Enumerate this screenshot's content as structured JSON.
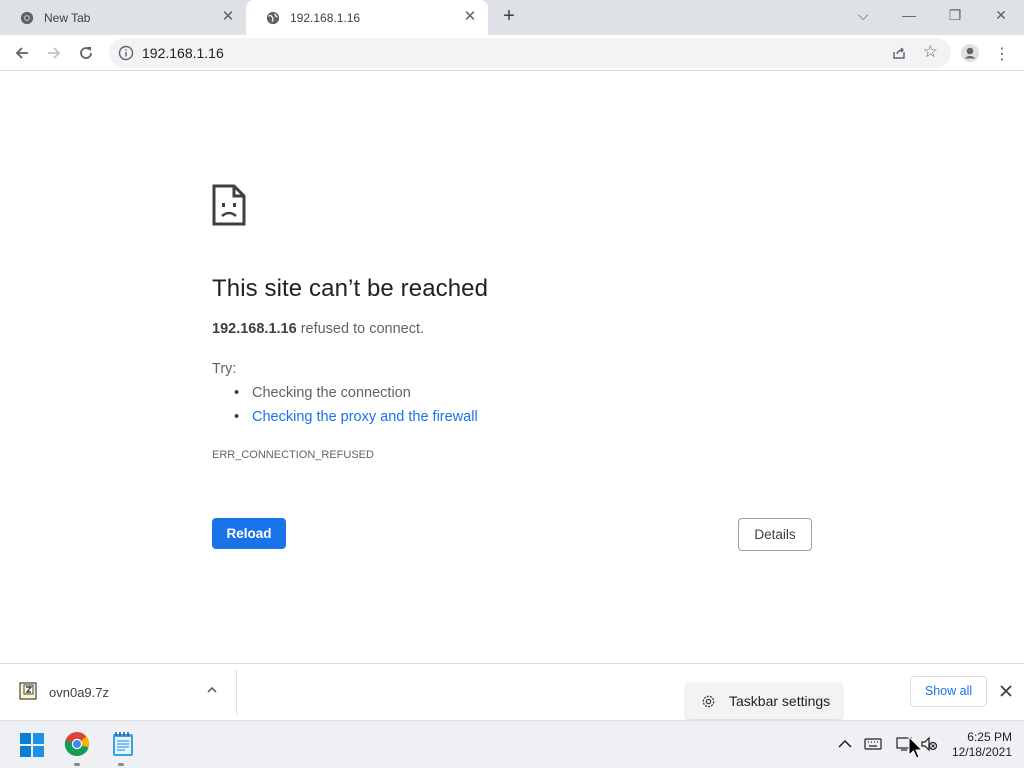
{
  "browser": {
    "tabs": [
      {
        "title": "New Tab",
        "icon": "chrome-icon",
        "active": false
      },
      {
        "title": "192.168.1.16",
        "icon": "globe-icon",
        "active": true
      }
    ],
    "address_bar": {
      "url": "192.168.1.16"
    }
  },
  "error_page": {
    "title": "This site can’t be reached",
    "host": "192.168.1.16",
    "description_suffix": " refused to connect.",
    "try_label": "Try:",
    "suggestions": [
      {
        "text": "Checking the connection",
        "is_link": false
      },
      {
        "text": "Checking the proxy and the firewall",
        "is_link": true
      }
    ],
    "error_code": "ERR_CONNECTION_REFUSED",
    "reload_label": "Reload",
    "details_label": "Details"
  },
  "download_bar": {
    "file_name": "ovn0a9.7z",
    "show_all_label": "Show all"
  },
  "taskbar_popup": {
    "label": "Taskbar settings"
  },
  "taskbar": {
    "time": "6:25 PM",
    "date": "12/18/2021",
    "pinned": [
      "start-icon",
      "chrome-icon",
      "notepad-icon"
    ]
  },
  "colors": {
    "accent": "#1a73e8",
    "tabstrip": "#dee1e6",
    "taskbar": "#eef0f3"
  }
}
